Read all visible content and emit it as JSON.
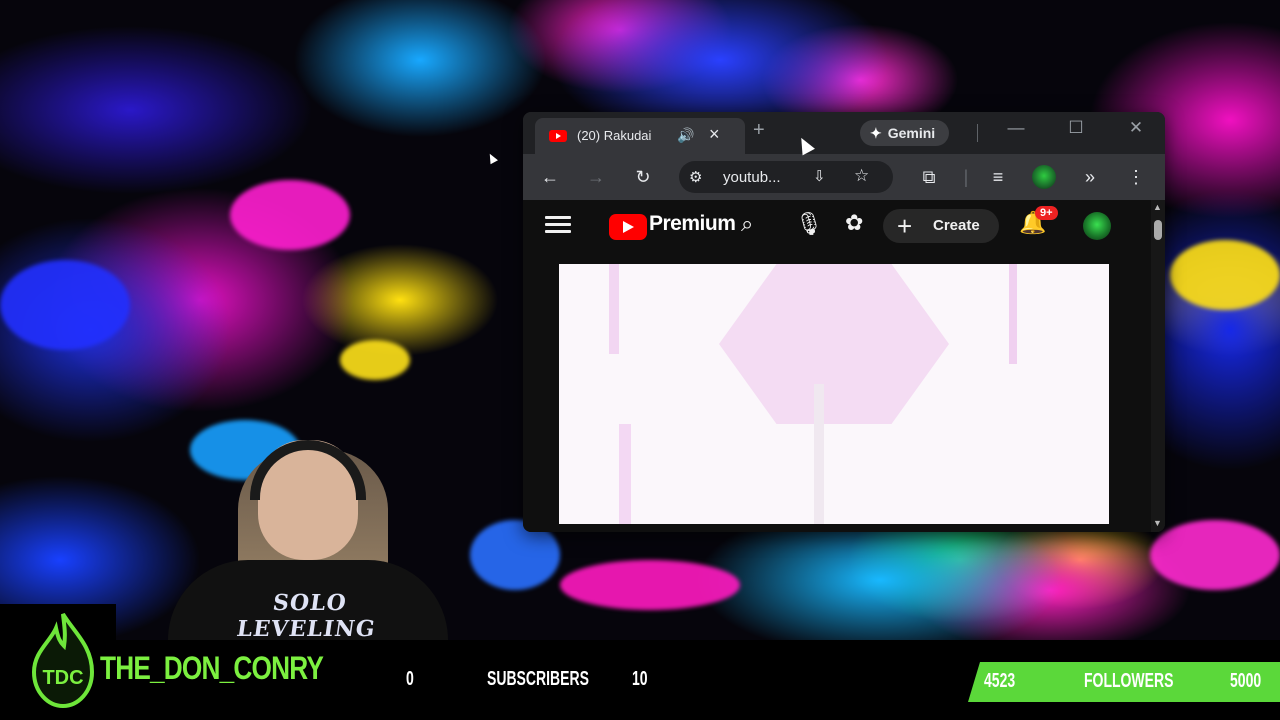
{
  "browser": {
    "tab": {
      "title": "(20) Rakudai"
    },
    "gemini_label": "Gemini",
    "address": {
      "url": "youtub..."
    }
  },
  "youtube": {
    "brand": "Premium",
    "create_label": "Create",
    "notifications_badge": "9+"
  },
  "overlay": {
    "channel_name": "THE_DON_CONRY",
    "logo_text": "TDC",
    "subscribers": {
      "current": "0",
      "label": "SUBSCRIBERS",
      "goal": "10"
    },
    "followers": {
      "current": "4523",
      "label": "FOLLOWERS",
      "goal": "5000"
    },
    "followers_progress": 0.9046,
    "shirt_text": "SOLO LEVELING"
  },
  "colors": {
    "brand_green": "#7cf040",
    "follow_bar": "#5bd83a",
    "youtube_red": "#ff0000"
  }
}
